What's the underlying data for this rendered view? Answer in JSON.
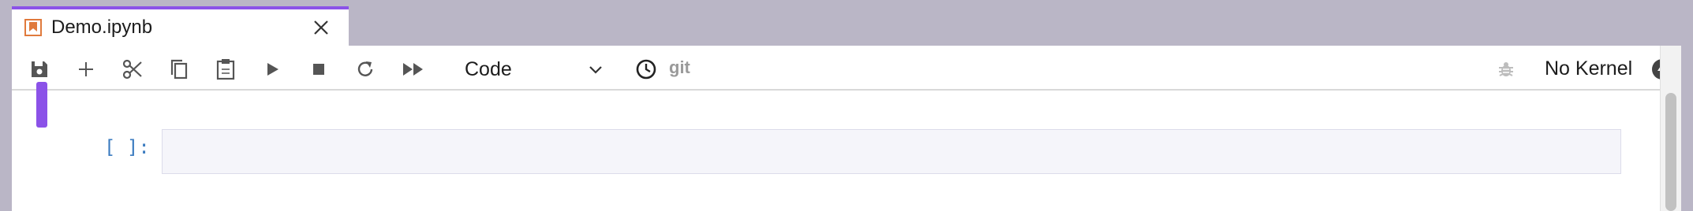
{
  "tab": {
    "title": "Demo.ipynb",
    "icon": "notebook-icon",
    "accent_color": "#8b52e8"
  },
  "toolbar": {
    "buttons": [
      {
        "name": "save",
        "icon": "save-icon"
      },
      {
        "name": "insert-cell",
        "icon": "plus-icon"
      },
      {
        "name": "cut",
        "icon": "scissors-icon"
      },
      {
        "name": "copy",
        "icon": "copy-icon"
      },
      {
        "name": "paste",
        "icon": "clipboard-icon"
      },
      {
        "name": "run",
        "icon": "play-icon"
      },
      {
        "name": "interrupt",
        "icon": "stop-icon"
      },
      {
        "name": "restart",
        "icon": "restart-icon"
      },
      {
        "name": "restart-run-all",
        "icon": "fast-forward-icon"
      }
    ],
    "cell_type": "Code",
    "history_icon": "clock-icon",
    "git_label": "git",
    "debugger_icon": "bug-icon",
    "kernel_name": "No Kernel",
    "kernel_status_icon": "lightning-icon"
  },
  "cell": {
    "prompt": "[ ]:",
    "source": "",
    "collapser_color": "#8b52e8"
  }
}
